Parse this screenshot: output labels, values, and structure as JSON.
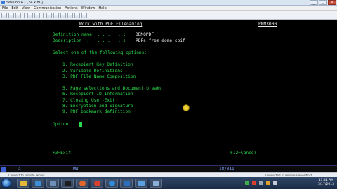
{
  "window": {
    "title": "Session A - [24 x 80]",
    "buttons": {
      "minimize": "_",
      "maximize": "□",
      "close": "×"
    }
  },
  "menubar": {
    "items": [
      "File",
      "Edit",
      "View",
      "Communication",
      "Actions",
      "Window",
      "Help"
    ]
  },
  "screen": {
    "heading": "Work with PDF Filenaming",
    "program_id": "PNM3000",
    "definition_name_label": "Definition name  . . . . . :",
    "definition_name_value": "DEMOPDF",
    "description_label": "Description  . . . . . . . :",
    "description_value": "PDFs from demo spif",
    "prompt": "Select one of the following options:",
    "options": [
      "1. Recepient Key Definition",
      "2. Variable Definitions",
      "3. PDF File Name Composition",
      "5. Page selections and Document breaks",
      "6. Recepient ID Information",
      "7. Closing User-Exit",
      "8. Encryption and Signature",
      "9. PDF bookmark definition"
    ],
    "option_label": "Option:",
    "fkey_exit": "F3=Exit",
    "fkey_cancel": "F12=Cancel"
  },
  "statusline": {
    "session_letter": "a",
    "mode": "MW",
    "cursor_position": "18/011"
  },
  "winstatus": {
    "left": "Connect to remote server",
    "right": "Connected to remote server/host"
  },
  "taskbar": {
    "time": "11:41 AM",
    "date": "5/17/2013"
  },
  "colors": {
    "terminal_green": "#2bd94b",
    "terminal_white": "#e8e8e8",
    "background": "#000000"
  }
}
